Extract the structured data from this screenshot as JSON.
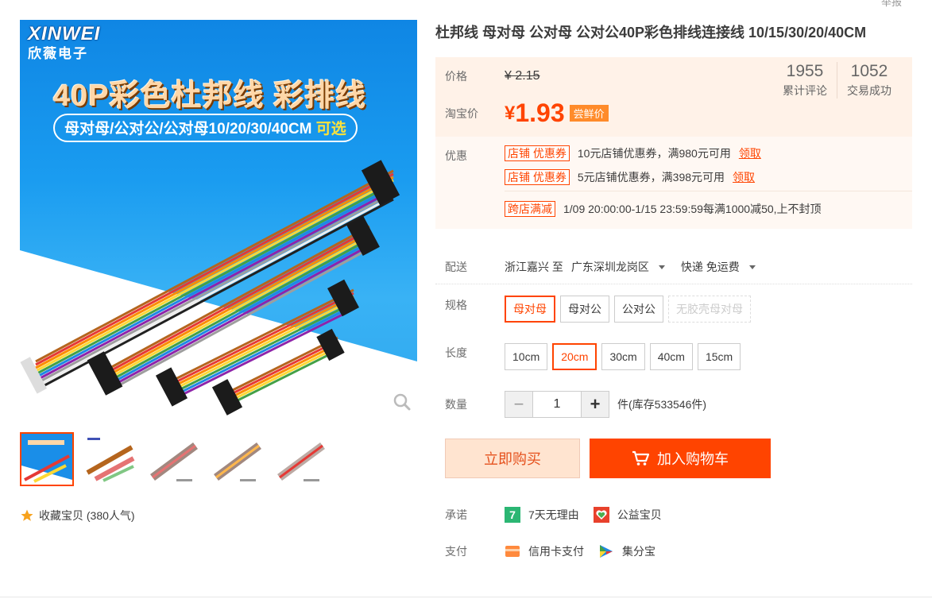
{
  "report_link": "举报",
  "gallery": {
    "brand_latin": "XINWEI",
    "brand_cn": "欣薇电子",
    "banner_title": "40P彩色杜邦线 彩排线",
    "banner_sub": "母对母/公对公/公对母10/20/30/40CM",
    "banner_sub_highlight": "可选",
    "favorite": "收藏宝贝 (380人气)"
  },
  "product": {
    "title": "杜邦线 母对母 公对母 公对公40P彩色排线连接线 10/15/30/20/40CM"
  },
  "price": {
    "label": "价格",
    "original": "¥ 2.15",
    "taobao_label": "淘宝价",
    "currency": "¥",
    "current": "1.93",
    "tag": "尝鲜价"
  },
  "stats": [
    {
      "value": "1955",
      "label": "累计评论"
    },
    {
      "value": "1052",
      "label": "交易成功"
    }
  ],
  "promotions": {
    "label": "优惠",
    "coupons": [
      {
        "tag": "店铺 优惠券",
        "text": "10元店铺优惠券，满980元可用",
        "action": "领取"
      },
      {
        "tag": "店铺 优惠券",
        "text": "5元店铺优惠券，满398元可用",
        "action": "领取"
      }
    ],
    "cross_store": {
      "tag": "跨店满减",
      "text": "1/09 20:00:00-1/15 23:59:59每满1000减50,上不封顶"
    }
  },
  "delivery": {
    "label": "配送",
    "from": "浙江嘉兴 至",
    "to": "广东深圳龙岗区",
    "shipping": "快递 免运费"
  },
  "spec": {
    "label": "规格",
    "options": [
      "母对母",
      "母对公",
      "公对公",
      "无胶壳母对母"
    ],
    "selected": "母对母"
  },
  "length": {
    "label": "长度",
    "options": [
      "10cm",
      "20cm",
      "30cm",
      "40cm",
      "15cm"
    ],
    "selected": "20cm"
  },
  "quantity": {
    "label": "数量",
    "value": "1",
    "unit_stock": "件(库存533546件)",
    "minus": "−",
    "plus": "+"
  },
  "actions": {
    "buy_now": "立即购买",
    "add_cart": "加入购物车"
  },
  "promise": {
    "label": "承诺",
    "items": [
      "7天无理由",
      "公益宝贝"
    ]
  },
  "payment": {
    "label": "支付",
    "items": [
      "信用卡支付",
      "集分宝"
    ]
  },
  "colors": {
    "accent": "#ff4400",
    "price_bg": "#fff2e8",
    "buy_bg": "#ffe4d0"
  }
}
